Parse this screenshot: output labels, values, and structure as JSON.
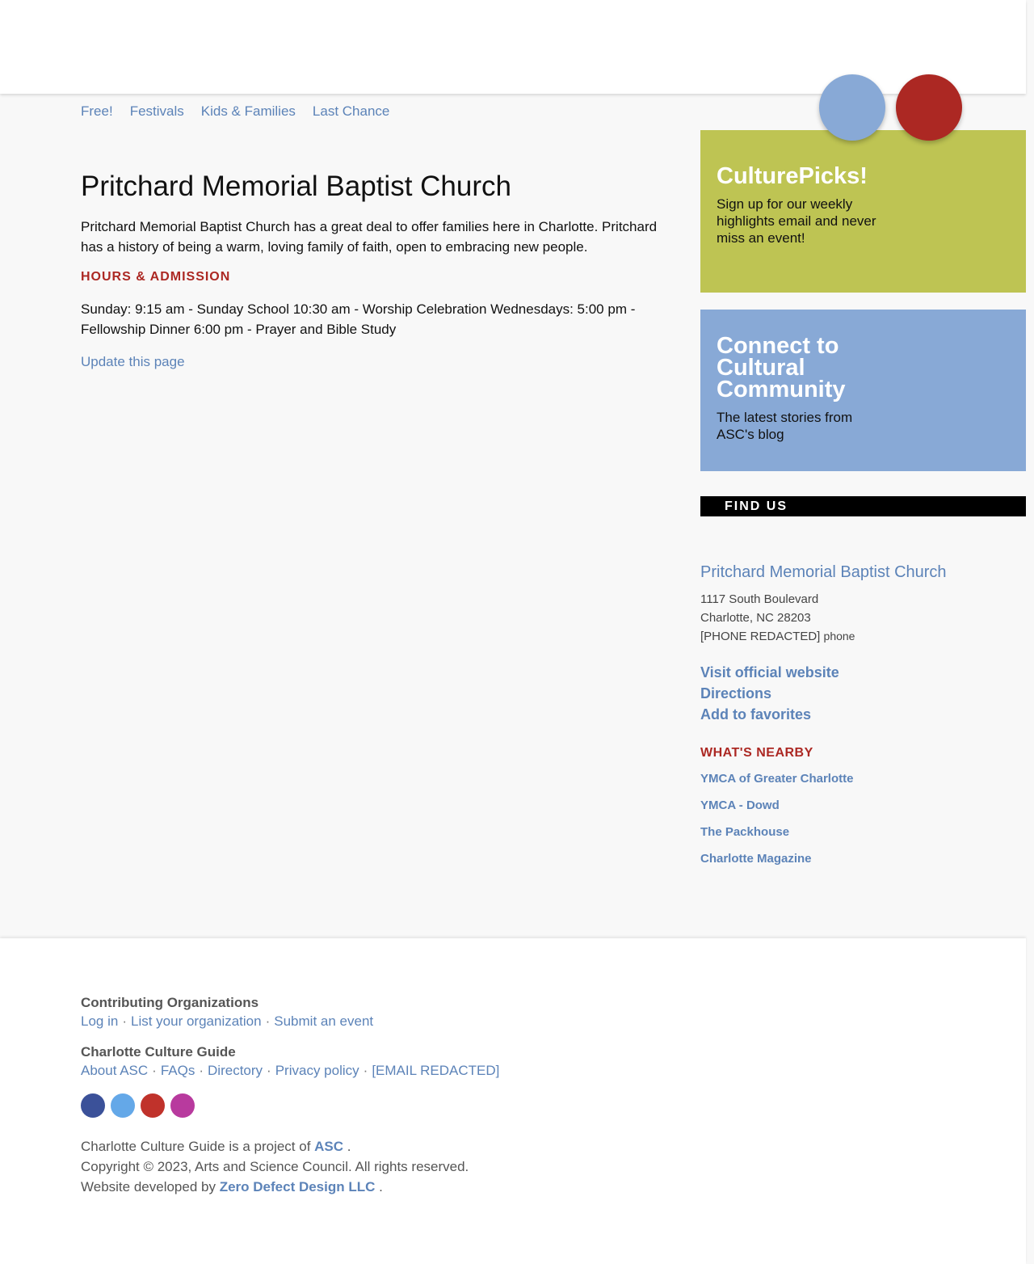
{
  "tags": [
    "Free!",
    "Festivals",
    "Kids & Families",
    "Last Chance"
  ],
  "main": {
    "title": "Pritchard Memorial Baptist Church",
    "description": "Pritchard Memorial Baptist Church has a great deal to offer families here in Charlotte. Pritchard has a history of being a warm, loving family of faith, open to embracing new people.",
    "hours_heading": "HOURS & ADMISSION",
    "hours": "Sunday: 9:15 am - Sunday School 10:30 am - Worship Celebration Wednesdays: 5:00 pm - Fellowship Dinner 6:00 pm - Prayer and Bible Study",
    "update_link": "Update this page"
  },
  "sidebar": {
    "culturepicks": {
      "title": "CulturePicks!",
      "text": "Sign up for our weekly highlights email and never miss an event!"
    },
    "connect": {
      "title": "Connect to Cultural Community",
      "text": "The latest stories from ASC's blog"
    },
    "find_us": "FIND US",
    "venue": {
      "name": "Pritchard Memorial Baptist Church",
      "street": "1117 South Boulevard",
      "city": "Charlotte, NC 28203",
      "phone": "[PHONE REDACTED]",
      "phone_label": "phone",
      "links": [
        "Visit official website",
        "Directions",
        "Add to favorites"
      ]
    },
    "nearby_heading": "WHAT'S NEARBY",
    "nearby": [
      "YMCA of Greater Charlotte",
      "YMCA - Dowd",
      "The Packhouse",
      "Charlotte Magazine"
    ]
  },
  "footer": {
    "contrib_heading": "Contributing Organizations",
    "contrib_links": [
      "Log in",
      "List your organization",
      "Submit an event"
    ],
    "guide_heading": "Charlotte Culture Guide",
    "guide_links": [
      "About ASC",
      "FAQs",
      "Directory",
      "Privacy policy",
      "[EMAIL REDACTED]"
    ],
    "social": [
      {
        "name": "facebook-icon",
        "color": "#3b5199"
      },
      {
        "name": "twitter-icon",
        "color": "#64a8e8"
      },
      {
        "name": "youtube-icon",
        "color": "#c0322b"
      },
      {
        "name": "instagram-icon",
        "color": "#b83a9e"
      }
    ],
    "credit_line1_prefix": "Charlotte Culture Guide is a project of",
    "credit_line1_link": "ASC",
    "credit_line2": "Copyright © 2023, Arts and Science Council. All rights reserved.",
    "credit_line3_prefix": "Website developed by",
    "credit_line3_link": "Zero Defect Design LLC",
    "period": "."
  },
  "colors": {
    "accent_blue": "#5c83b8",
    "accent_red": "#ac2823",
    "promo_green": "#bec453",
    "promo_blue": "#88a9d6"
  }
}
